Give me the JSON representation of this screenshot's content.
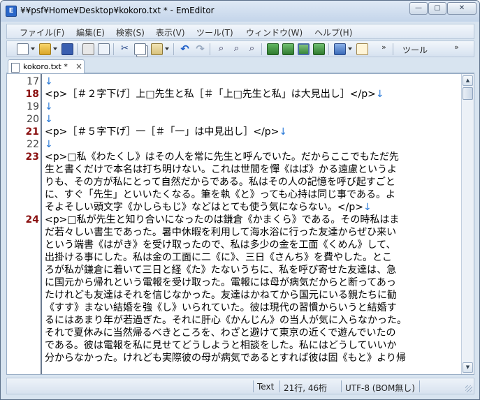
{
  "window": {
    "title": "¥¥psf¥Home¥Desktop¥kokoro.txt * - EmEditor",
    "minimize_glyph": "—",
    "maximize_glyph": "▢",
    "close_glyph": "✕"
  },
  "menu": {
    "items": [
      {
        "label": "ファイル(F)"
      },
      {
        "label": "編集(E)"
      },
      {
        "label": "検索(S)"
      },
      {
        "label": "表示(V)"
      },
      {
        "label": "ツール(T)"
      },
      {
        "label": "ウィンドウ(W)"
      },
      {
        "label": "ヘルプ(H)"
      }
    ]
  },
  "toolbar": {
    "more_glyph": "»",
    "tools_label": "ツール"
  },
  "tab": {
    "label": "kokoro.txt *",
    "close_glyph": "×"
  },
  "editor": {
    "lines": [
      {
        "num": "17",
        "text": "",
        "eol": "↓",
        "current": false
      },
      {
        "num": "18",
        "text": "<p>［＃２字下げ］上□先生と私［＃「上□先生と私」は大見出し］</p>",
        "eol": "↓",
        "current": true
      },
      {
        "num": "19",
        "text": "",
        "eol": "↓",
        "current": false
      },
      {
        "num": "20",
        "text": "",
        "eol": "↓",
        "current": false
      },
      {
        "num": "21",
        "text": "<p>［＃５字下げ］一［＃「一」は中見出し］</p>",
        "eol": "↓",
        "current": true
      },
      {
        "num": "22",
        "text": "",
        "eol": "↓",
        "current": false
      },
      {
        "num": "23",
        "text": "<p>□私《わたくし》はその人を常に先生と呼んでいた。だからここでもただ先",
        "eol": "",
        "current": true
      },
      {
        "num": "",
        "text": "生と書くだけで本名は打ち明けない。これは世間を憚《はば》かる遠慮というよ",
        "eol": "",
        "current": false
      },
      {
        "num": "",
        "text": "りも、その方が私にとって自然だからである。私はその人の記憶を呼び起すごと",
        "eol": "",
        "current": false
      },
      {
        "num": "",
        "text": "に、すぐ「先生」といいたくなる。筆を執《と》っても心持は同じ事である。よ",
        "eol": "",
        "current": false
      },
      {
        "num": "",
        "text": "そよそしい頭文字《かしらもじ》などはとても使う気にならない。</p>",
        "eol": "↓",
        "current": false
      },
      {
        "num": "24",
        "text": "<p>□私が先生と知り合いになったのは鎌倉《かまくら》である。その時私はま",
        "eol": "",
        "current": true
      },
      {
        "num": "",
        "text": "だ若々しい書生であった。暑中休暇を利用して海水浴に行った友達からぜひ来い",
        "eol": "",
        "current": false
      },
      {
        "num": "",
        "text": "という端書《はがき》を受け取ったので、私は多少の金を工面《くめん》して、",
        "eol": "",
        "current": false
      },
      {
        "num": "",
        "text": "出掛ける事にした。私は金の工面に二《に》、三日《さんち》を費やした。とこ",
        "eol": "",
        "current": false
      },
      {
        "num": "",
        "text": "ろが私が鎌倉に着いて三日と経《た》たないうちに、私を呼び寄せた友達は、急",
        "eol": "",
        "current": false
      },
      {
        "num": "",
        "text": "に国元から帰れという電報を受け取った。電報には母が病気だからと断ってあっ",
        "eol": "",
        "current": false
      },
      {
        "num": "",
        "text": "たけれども友達はそれを信じなかった。友達はかねてから国元にいる親たちに勧",
        "eol": "",
        "current": false
      },
      {
        "num": "",
        "text": "《すす》まない結婚を強《し》いられていた。彼は現代の習慣からいうと結婚す",
        "eol": "",
        "current": false
      },
      {
        "num": "",
        "text": "るにはあまり年が若過ぎた。それに肝心《かんじん》の当人が気に入らなかった。",
        "eol": "",
        "current": false
      },
      {
        "num": "",
        "text": "それで夏休みに当然帰るべきところを、わざと避けて東京の近くで遊んでいたの",
        "eol": "",
        "current": false
      },
      {
        "num": "",
        "text": "である。彼は電報を私に見せてどうしようと相談をした。私にはどうしていいか",
        "eol": "",
        "current": false
      },
      {
        "num": "",
        "text": "分からなかった。けれども実際彼の母が病気であるとすれば彼は固《もと》より帰",
        "eol": "",
        "current": false
      }
    ]
  },
  "statusbar": {
    "mode": "Text",
    "position": "21行, 46桁",
    "encoding": "UTF-8 (BOM無し)"
  },
  "colors": {
    "eol_marker": "#2a7ad8",
    "current_line_number": "#8a1010"
  }
}
